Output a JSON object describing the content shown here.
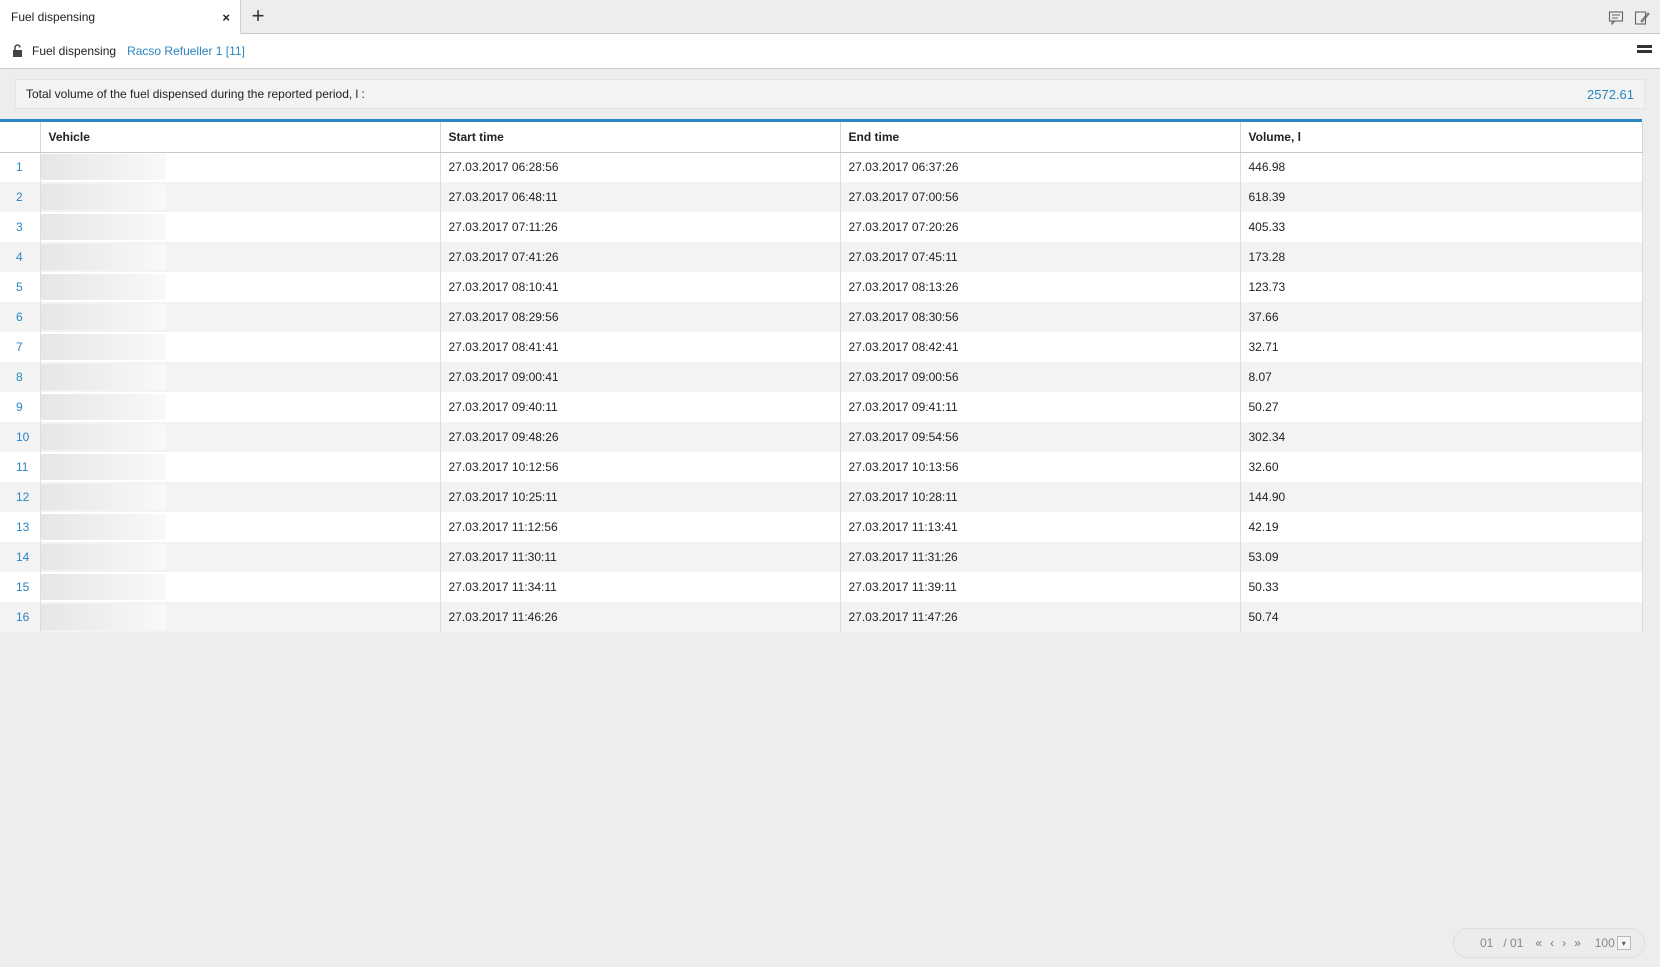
{
  "tab": {
    "title": "Fuel dispensing",
    "close": "×",
    "add": "+"
  },
  "icons": {
    "chat": "chat-icon",
    "edit": "edit-notes-icon",
    "lock": "unlock-icon",
    "menu": "menu-icon"
  },
  "report": {
    "title": "Fuel dispensing",
    "unit": "Racso Refueller 1 [11]"
  },
  "summary": {
    "label": "Total volume of the fuel dispensed during the reported period, l :",
    "value": "2572.61"
  },
  "table": {
    "headers": {
      "vehicle": "Vehicle",
      "start": "Start time",
      "end": "End time",
      "volume": "Volume, l"
    },
    "rows": [
      {
        "num": "1",
        "start": "27.03.2017 06:28:56",
        "end": "27.03.2017 06:37:26",
        "volume": "446.98"
      },
      {
        "num": "2",
        "start": "27.03.2017 06:48:11",
        "end": "27.03.2017 07:00:56",
        "volume": "618.39"
      },
      {
        "num": "3",
        "start": "27.03.2017 07:11:26",
        "end": "27.03.2017 07:20:26",
        "volume": "405.33"
      },
      {
        "num": "4",
        "start": "27.03.2017 07:41:26",
        "end": "27.03.2017 07:45:11",
        "volume": "173.28"
      },
      {
        "num": "5",
        "start": "27.03.2017 08:10:41",
        "end": "27.03.2017 08:13:26",
        "volume": "123.73"
      },
      {
        "num": "6",
        "start": "27.03.2017 08:29:56",
        "end": "27.03.2017 08:30:56",
        "volume": "37.66"
      },
      {
        "num": "7",
        "start": "27.03.2017 08:41:41",
        "end": "27.03.2017 08:42:41",
        "volume": "32.71"
      },
      {
        "num": "8",
        "start": "27.03.2017 09:00:41",
        "end": "27.03.2017 09:00:56",
        "volume": "8.07"
      },
      {
        "num": "9",
        "start": "27.03.2017 09:40:11",
        "end": "27.03.2017 09:41:11",
        "volume": "50.27"
      },
      {
        "num": "10",
        "start": "27.03.2017 09:48:26",
        "end": "27.03.2017 09:54:56",
        "volume": "302.34"
      },
      {
        "num": "11",
        "start": "27.03.2017 10:12:56",
        "end": "27.03.2017 10:13:56",
        "volume": "32.60"
      },
      {
        "num": "12",
        "start": "27.03.2017 10:25:11",
        "end": "27.03.2017 10:28:11",
        "volume": "144.90"
      },
      {
        "num": "13",
        "start": "27.03.2017 11:12:56",
        "end": "27.03.2017 11:13:41",
        "volume": "42.19"
      },
      {
        "num": "14",
        "start": "27.03.2017 11:30:11",
        "end": "27.03.2017 11:31:26",
        "volume": "53.09"
      },
      {
        "num": "15",
        "start": "27.03.2017 11:34:11",
        "end": "27.03.2017 11:39:11",
        "volume": "50.33"
      },
      {
        "num": "16",
        "start": "27.03.2017 11:46:26",
        "end": "27.03.2017 11:47:26",
        "volume": "50.74"
      }
    ]
  },
  "pager": {
    "current": "01",
    "total": "/ 01",
    "first": "«",
    "prev": "‹",
    "next": "›",
    "last": "»",
    "page_size": "100",
    "dropdown": "▾"
  },
  "colors": {
    "accent": "#2a86c2"
  }
}
